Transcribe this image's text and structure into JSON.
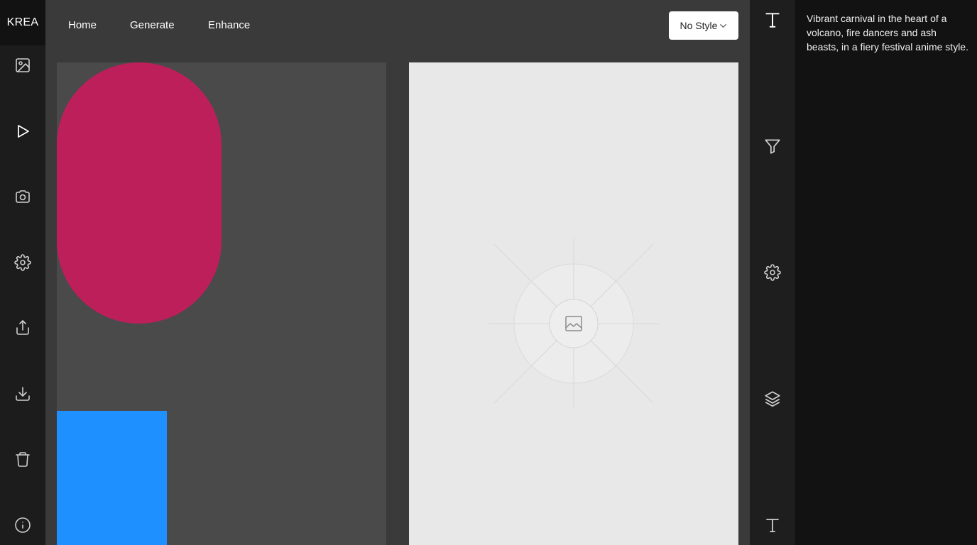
{
  "app": {
    "logo": "KREA"
  },
  "nav": {
    "links": [
      "Home",
      "Generate",
      "Enhance"
    ],
    "style_select": {
      "value": "No Style"
    }
  },
  "left_sidebar": {
    "icons": [
      "image-icon",
      "play-icon",
      "camera-icon",
      "settings-icon",
      "share-icon",
      "download-icon",
      "trash-icon",
      "info-icon"
    ]
  },
  "right_toolbar": {
    "icons": [
      "text-icon",
      "filter-icon",
      "settings-icon",
      "layers-icon",
      "text-icon"
    ]
  },
  "canvas": {
    "shapes": [
      {
        "name": "pill-shape",
        "color": "#bc1f5a"
      },
      {
        "name": "blue-rectangle",
        "color": "#1e90ff"
      }
    ],
    "output_placeholder_icon": "image-placeholder-icon"
  },
  "prompt": {
    "text": "Vibrant carnival in the heart of a volcano, fire dancers and ash beasts, in a fiery festival anime style."
  },
  "colors": {
    "sidebar": "#1c1c1c",
    "panel": "#121212",
    "canvas_bg": "#4a4a4a",
    "output_bg": "#e8e8e8"
  }
}
